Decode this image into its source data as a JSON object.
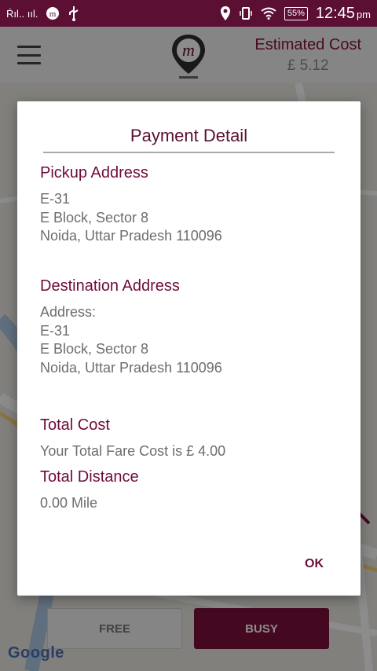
{
  "status_bar": {
    "signal_text": "Ŕıl.. ııl.",
    "time": "12:45",
    "time_suffix": "pm",
    "battery": "55%"
  },
  "app_bar": {
    "menu_icon": "hamburger-icon",
    "logo_icon": "m-driver-logo",
    "estimated_cost_label": "Estimated Cost",
    "estimated_cost_value": "£ 5.12"
  },
  "dialog": {
    "title": "Payment Detail",
    "pickup_label": "Pickup Address",
    "pickup_lines": [
      "E-31",
      "E Block, Sector 8",
      "Noida, Uttar Pradesh 110096"
    ],
    "destination_label": "Destination Address",
    "destination_lines": [
      "Address:",
      "E-31",
      "E Block, Sector 8",
      "Noida, Uttar Pradesh 110096"
    ],
    "total_cost_label": "Total Cost",
    "total_cost_text": "Your Total Fare Cost is £ 4.00",
    "total_distance_label": "Total Distance",
    "total_distance_text": "0.00 Mile",
    "ok_label": "OK"
  },
  "bottom": {
    "free_label": "FREE",
    "busy_label": "BUSY"
  },
  "map": {
    "attribution": "Google"
  },
  "colors": {
    "brand": "#5a0f33",
    "accent": "#7c0f3c"
  }
}
